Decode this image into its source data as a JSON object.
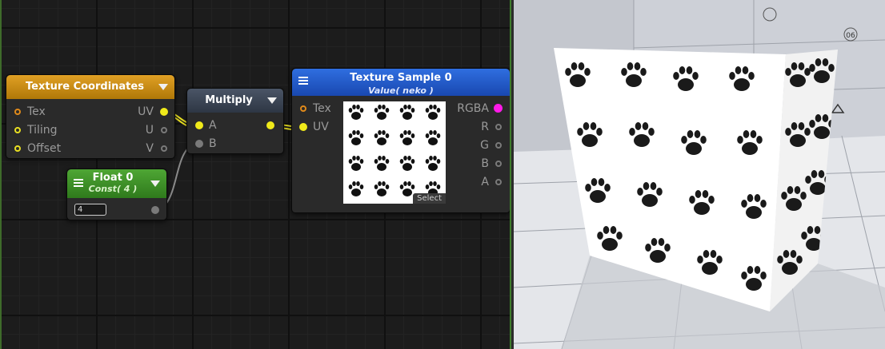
{
  "nodes": {
    "texture_coordinates": {
      "title": "Texture Coordinates",
      "inputs": [
        "Tex",
        "Tiling",
        "Offset"
      ],
      "outputs": [
        "UV",
        "U",
        "V"
      ],
      "header_color": "#c98a10"
    },
    "multiply": {
      "title": "Multiply",
      "inputs": [
        "A",
        "B"
      ],
      "header_color": "#3b4656"
    },
    "texture_sample": {
      "title": "Texture Sample 0",
      "subtitle": "Value( neko )",
      "inputs": [
        "Tex",
        "UV"
      ],
      "outputs": [
        "RGBA",
        "R",
        "G",
        "B",
        "A"
      ],
      "select_label": "Select",
      "header_color": "#1f56c4"
    },
    "float": {
      "title": "Float 0",
      "subtitle": "Const( 4 )",
      "value": "4",
      "header_color": "#3e8e26"
    }
  },
  "viewport": {
    "gizmo_label": "06"
  },
  "icons": [
    "hamburger-icon",
    "dropdown-arrow-icon",
    "paw-print-icon",
    "unity-logo-icon"
  ]
}
